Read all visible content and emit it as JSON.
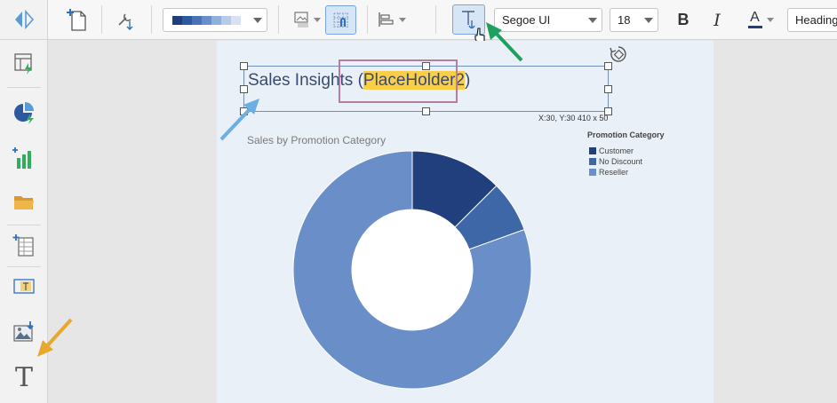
{
  "toolbar": {
    "font": "Segoe UI",
    "font_size": "18",
    "style": "Heading",
    "bold_label": "B",
    "italic_label": "I",
    "font_color_label": "A",
    "palette_colors": [
      "#1f3f7a",
      "#2d5a9e",
      "#4a73b5",
      "#6a8ecb",
      "#8fafdc",
      "#b6cbea",
      "#d6e1f3"
    ]
  },
  "canvas": {
    "title_prefix": "Sales Insights (",
    "title_placeholder": "PlaceHolder2",
    "title_suffix": ")",
    "coordinates": "X:30, Y:30 410 x 50",
    "chart_title": "Sales by Promotion Category"
  },
  "chart_data": {
    "type": "pie",
    "title": "Sales by Promotion Category",
    "legend_title": "Promotion Category",
    "legend_position": "top-right",
    "donut": true,
    "categories": [
      "Customer",
      "No Discount",
      "Reseller"
    ],
    "values": [
      12.5,
      7,
      80.5
    ],
    "colors": [
      "#213f7c",
      "#3d67a6",
      "#6a8ec8"
    ]
  },
  "colors": {
    "accent": "#2f6fc0",
    "canvas_bg": "#eaf0f8",
    "highlight": "#f9cf4a",
    "placeholder_border": "#b57ea0",
    "arrow_blue": "#6aaee3",
    "arrow_green": "#20a060",
    "arrow_orange": "#e8a82c"
  }
}
